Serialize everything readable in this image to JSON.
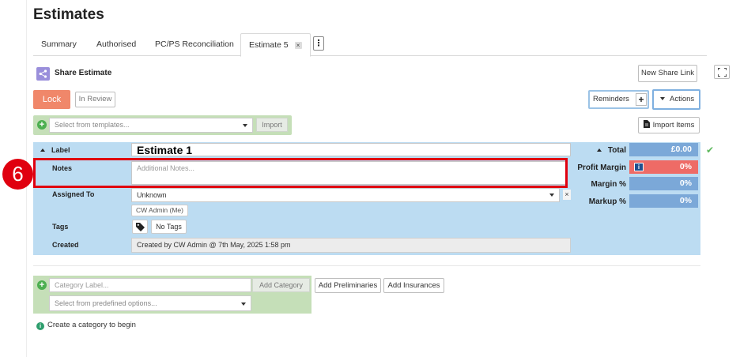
{
  "page": {
    "title": "Estimates"
  },
  "tabs": [
    {
      "label": "Summary"
    },
    {
      "label": "Authorised"
    },
    {
      "label": "PC/PS Reconciliation"
    },
    {
      "label": "Estimate 5",
      "active": true,
      "closable": true
    }
  ],
  "tabs_more_glyph": "⋮",
  "share": {
    "label": "Share Estimate",
    "new_link_label": "New Share Link"
  },
  "toolbar": {
    "lock_label": "Lock",
    "in_review_label": "In Review",
    "reminders_label": "Reminders",
    "reminders_add_glyph": "+",
    "actions_label": "Actions",
    "import_items_label": "Import Items"
  },
  "templates": {
    "placeholder": "Select from templates...",
    "import_label": "Import"
  },
  "form": {
    "label_caption": "Label",
    "label_value": "Estimate 1",
    "notes_caption": "Notes",
    "notes_placeholder": "Additional Notes...",
    "assigned_caption": "Assigned To",
    "assigned_value": "Unknown",
    "assigned_chip": "CW Admin (Me)",
    "clear_glyph": "×",
    "tags_caption": "Tags",
    "tags_value": "No Tags",
    "created_caption": "Created",
    "created_value": "Created by CW Admin @ 7th May, 2025 1:58 pm"
  },
  "totals": {
    "total_label": "Total",
    "total_value": "£0.00",
    "profit_margin_label": "Profit Margin",
    "profit_margin_value": "0%",
    "margin_label": "Margin %",
    "margin_value": "0%",
    "markup_label": "Markup %",
    "markup_value": "0%",
    "check_glyph": "✔"
  },
  "annotation": {
    "step": "6"
  },
  "category": {
    "label_placeholder": "Category Label...",
    "add_label": "Add Category",
    "predefined_placeholder": "Select from predefined options...",
    "add_preliminaries_label": "Add Preliminaries",
    "add_insurances_label": "Add Insurances",
    "hint": "Create a category to begin"
  },
  "colors": {
    "lock": "#f0876a",
    "panel": "#bcdcf2",
    "total_value_bg": "#7ba8d8",
    "profit_value_bg": "#ee6b66",
    "green_bar": "#c5dfb8",
    "highlight": "#e0000f"
  }
}
